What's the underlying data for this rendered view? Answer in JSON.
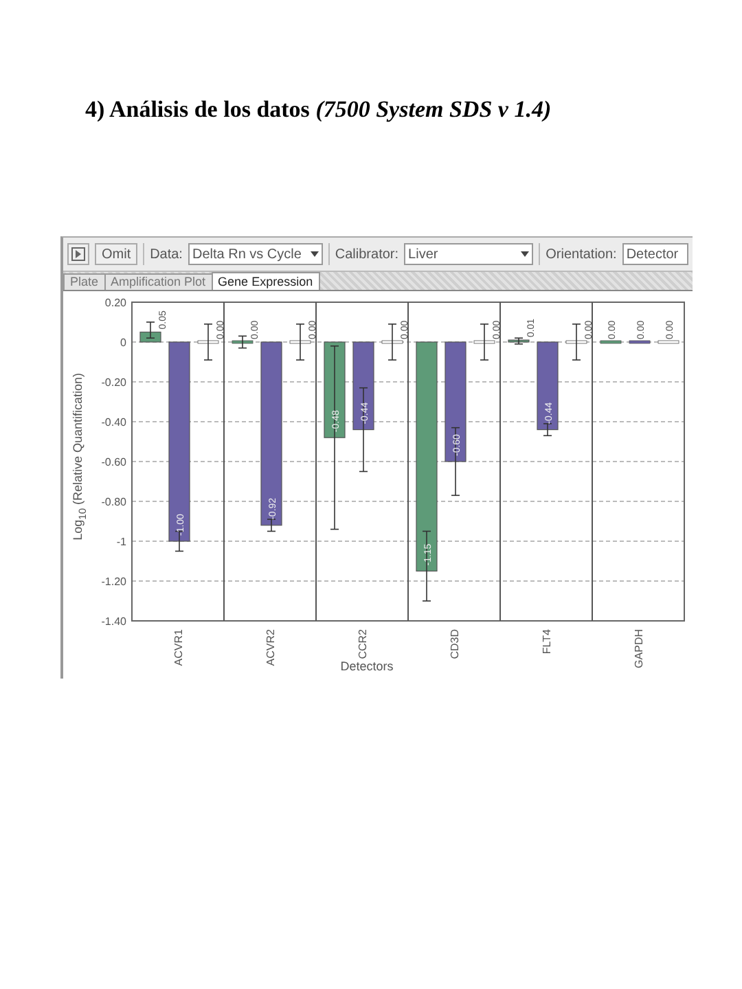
{
  "heading": "4) Análisis de los datos *(7500 System SDS v 1.4)*",
  "toolbar": {
    "omit_button": "Omit",
    "data_label": "Data:",
    "data_value": "Delta Rn vs Cycle",
    "calibrator_label": "Calibrator:",
    "calibrator_value": "Liver",
    "orientation_label": "Orientation:",
    "orientation_value": "Detector"
  },
  "tabs": [
    {
      "label": "Plate",
      "selected": false
    },
    {
      "label": "Amplification Plot",
      "selected": false
    },
    {
      "label": "Gene Expression",
      "selected": true
    }
  ],
  "chart_data": {
    "type": "bar",
    "xlabel": "Detectors",
    "ylabel": "Log$_{10}$ (Relative Quantification)",
    "categories": [
      "ACVR1",
      "ACVR2",
      "CCR2",
      "CD3D",
      "FLT4",
      "GAPDH"
    ],
    "ylim": [
      -1.4,
      0.2
    ],
    "grid": true,
    "yticks": [
      {
        "value": 0.2,
        "label": "0.20"
      },
      {
        "value": 0,
        "label": "0"
      },
      {
        "value": -0.2,
        "label": "-0.20"
      },
      {
        "value": -0.4,
        "label": "-0.40"
      },
      {
        "value": -0.6,
        "label": "-0.60"
      },
      {
        "value": -0.8,
        "label": "-0.80"
      },
      {
        "value": -1,
        "label": "-1"
      },
      {
        "value": -1.2,
        "label": "-1.20"
      },
      {
        "value": -1.4,
        "label": "-1.40"
      }
    ],
    "series": [
      {
        "color": "#5e9b78",
        "values": [
          0.05,
          0.0,
          -0.48,
          -1.15,
          0.01,
          0.0
        ],
        "errors": [
          [
            0.02,
            0.1
          ],
          [
            -0.03,
            0.03
          ],
          [
            -0.94,
            -0.02
          ],
          [
            -1.3,
            -0.95
          ],
          [
            -0.01,
            0.02
          ],
          null
        ],
        "value_labels": [
          "0.05",
          "0.00",
          "-0.48",
          "-1.15",
          "0.01",
          "0.00"
        ]
      },
      {
        "color": "#6b62a6",
        "values": [
          -1.0,
          -0.92,
          -0.44,
          -0.6,
          -0.44,
          0.0
        ],
        "errors": [
          [
            -1.05,
            -0.95
          ],
          [
            -0.95,
            -0.89
          ],
          [
            -0.65,
            -0.23
          ],
          [
            -0.77,
            -0.43
          ],
          [
            -0.47,
            -0.41
          ],
          null
        ],
        "value_labels": [
          "-1.00",
          "-0.92",
          "-0.44",
          "-0.60",
          "-0.44",
          "0.00"
        ]
      },
      {
        "color": "#ffffff",
        "values": [
          0.0,
          0.0,
          0.0,
          0.0,
          0.0,
          0.0
        ],
        "errors": [
          [
            -0.09,
            0.09
          ],
          [
            -0.09,
            0.09
          ],
          [
            -0.09,
            0.09
          ],
          [
            -0.09,
            0.09
          ],
          [
            -0.09,
            0.09
          ],
          null
        ],
        "value_labels": [
          "0.00",
          "0.00",
          "0.00",
          "0.00",
          "0.00",
          "0.00"
        ]
      }
    ]
  }
}
